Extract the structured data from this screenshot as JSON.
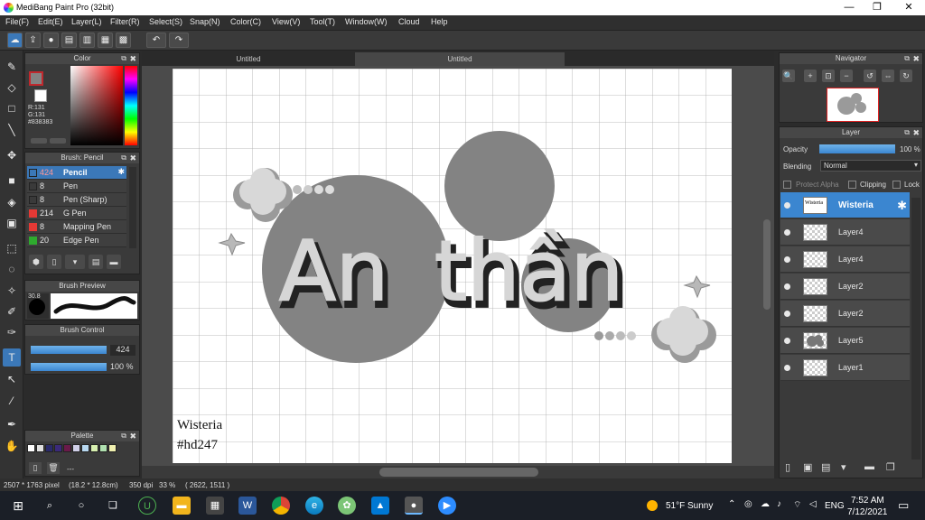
{
  "window": {
    "title": "MediBang Paint Pro (32bit)",
    "minimize": "—",
    "restore": "❐",
    "close": "✕"
  },
  "menu": [
    "File(F)",
    "Edit(E)",
    "Layer(L)",
    "Filter(R)",
    "Select(S)",
    "Snap(N)",
    "Color(C)",
    "View(V)",
    "Tool(T)",
    "Window(W)",
    "Cloud",
    "Help"
  ],
  "color_panel": {
    "title": "Color",
    "r": "R:131",
    "g": "G:131",
    "b": "B:131",
    "hex": "#838383",
    "primary_color": "#838383",
    "accent": "#c0282d"
  },
  "brush_panel": {
    "title": "Brush: Pencil",
    "items": [
      {
        "size": "424",
        "name": "Pencil",
        "color": "#3b78b8"
      },
      {
        "size": "8",
        "name": "Pen",
        "color": "#3a3a3a"
      },
      {
        "size": "8",
        "name": "Pen (Sharp)",
        "color": "#3a3a3a"
      },
      {
        "size": "214",
        "name": "G Pen",
        "color": "#e53935"
      },
      {
        "size": "8",
        "name": "Mapping Pen",
        "color": "#e53935"
      },
      {
        "size": "20",
        "name": "Edge Pen",
        "color": "#2eaa2e"
      }
    ]
  },
  "brush_preview": {
    "title": "Brush Preview",
    "size_label": "30.8"
  },
  "brush_control": {
    "title": "Brush Control",
    "size": "424",
    "opacity": "100 %"
  },
  "palette": {
    "title": "Palette",
    "more": "---",
    "colors": [
      "#ffffff",
      "#e0e0e0",
      "#2a2a6a",
      "#3b2a7a",
      "#6a1a4a",
      "#d0d0e8",
      "#b8d8f0",
      "#d8f0b0",
      "#b0e0b0",
      "#f0f0b0"
    ]
  },
  "tabs": [
    "Untitled",
    "Untitled"
  ],
  "canvas_art": {
    "title_word1": "An",
    "title_word2": "thần",
    "credit_line1": "Wisteria",
    "credit_line2": "#hd247"
  },
  "navigator": {
    "title": "Navigator"
  },
  "layer_panel": {
    "title": "Layer",
    "opacity_label": "Opacity",
    "opacity_value": "100 %",
    "blending_label": "Blending",
    "blending_value": "Normal",
    "protect_alpha": "Protect Alpha",
    "clipping": "Clipping",
    "lock": "Lock",
    "layers": [
      "Wisteria",
      "Layer4",
      "Layer4",
      "Layer2",
      "Layer2",
      "Layer5",
      "Layer1"
    ],
    "selected_thumb_text": "Wisteria"
  },
  "status": {
    "dimensions": "2507 * 1763 pixel",
    "physical": "(18.2 * 12.8cm)",
    "dpi": "350 dpi",
    "zoom": "33 %",
    "coords": "( 2622, 1511 )"
  },
  "taskbar": {
    "weather": "51°F  Sunny",
    "lang": "ENG",
    "time": "7:52 AM",
    "date": "7/12/2021"
  },
  "icons": [
    "app-icon",
    "undo-icon",
    "redo-icon",
    "brush-icon",
    "eraser-icon",
    "move-icon",
    "fill-icon",
    "text-icon",
    "eyedropper-icon",
    "hand-icon",
    "search-icon",
    "zoom-in-icon",
    "zoom-out-icon",
    "eye-icon",
    "gear-icon"
  ]
}
